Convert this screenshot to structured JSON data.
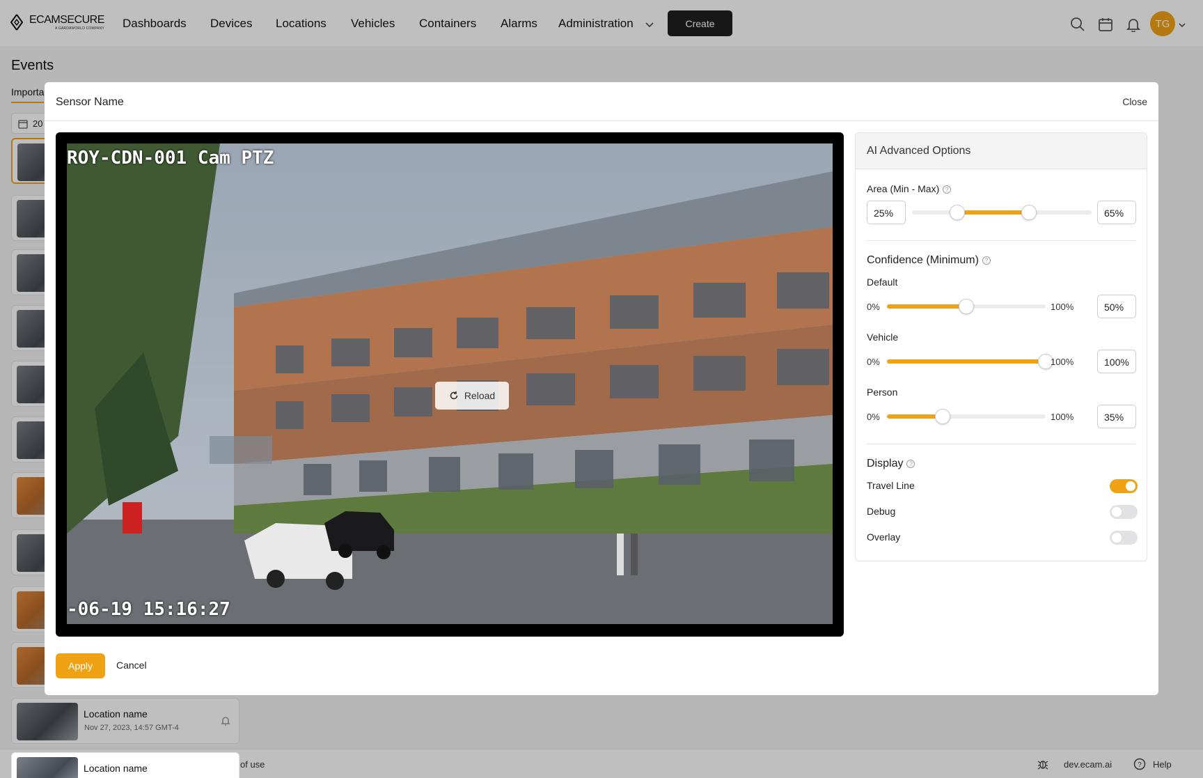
{
  "app": {
    "logo_text": "ECAMSECURE",
    "logo_sub": "A GARDAWORLD COMPANY",
    "nav": [
      "Dashboards",
      "Devices",
      "Locations",
      "Vehicles",
      "Containers",
      "Alarms",
      "Administration"
    ],
    "create_label": "Create",
    "avatar_initials": "TG",
    "accent_color": "#f0a215"
  },
  "page": {
    "title": "Events",
    "tab": "Importa",
    "date_chip": "20",
    "cards": [
      {
        "title": "Location name",
        "date": "Nov 27, 2023, 14:57 GMT-4"
      },
      {
        "title": "Location name",
        "date": ""
      }
    ],
    "footer": {
      "terms": "of use",
      "domain": "dev.ecam.ai",
      "help": "Help"
    }
  },
  "modal": {
    "title": "Sensor Name",
    "close_label": "Close",
    "camera_label": "ROY-CDN-001 Cam PTZ",
    "camera_time": "-06-19 15:16:27",
    "reload_label": "Reload",
    "apply_label": "Apply",
    "cancel_label": "Cancel",
    "panel": {
      "title": "AI Advanced Options",
      "area": {
        "label": "Area (Min - Max)",
        "min_text": "25%",
        "max_text": "65%",
        "min": 25,
        "max": 65
      },
      "confidence": {
        "label": "Confidence (Minimum)",
        "range_min": "0%",
        "range_max": "100%",
        "rows": [
          {
            "label": "Default",
            "value_text": "50%",
            "value": 50
          },
          {
            "label": "Vehicle",
            "value_text": "100%",
            "value": 100
          },
          {
            "label": "Person",
            "value_text": "35%",
            "value": 35
          }
        ]
      },
      "display": {
        "label": "Display",
        "toggles": [
          {
            "label": "Travel Line",
            "on": true
          },
          {
            "label": "Debug",
            "on": false
          },
          {
            "label": "Overlay",
            "on": false
          }
        ]
      }
    }
  }
}
